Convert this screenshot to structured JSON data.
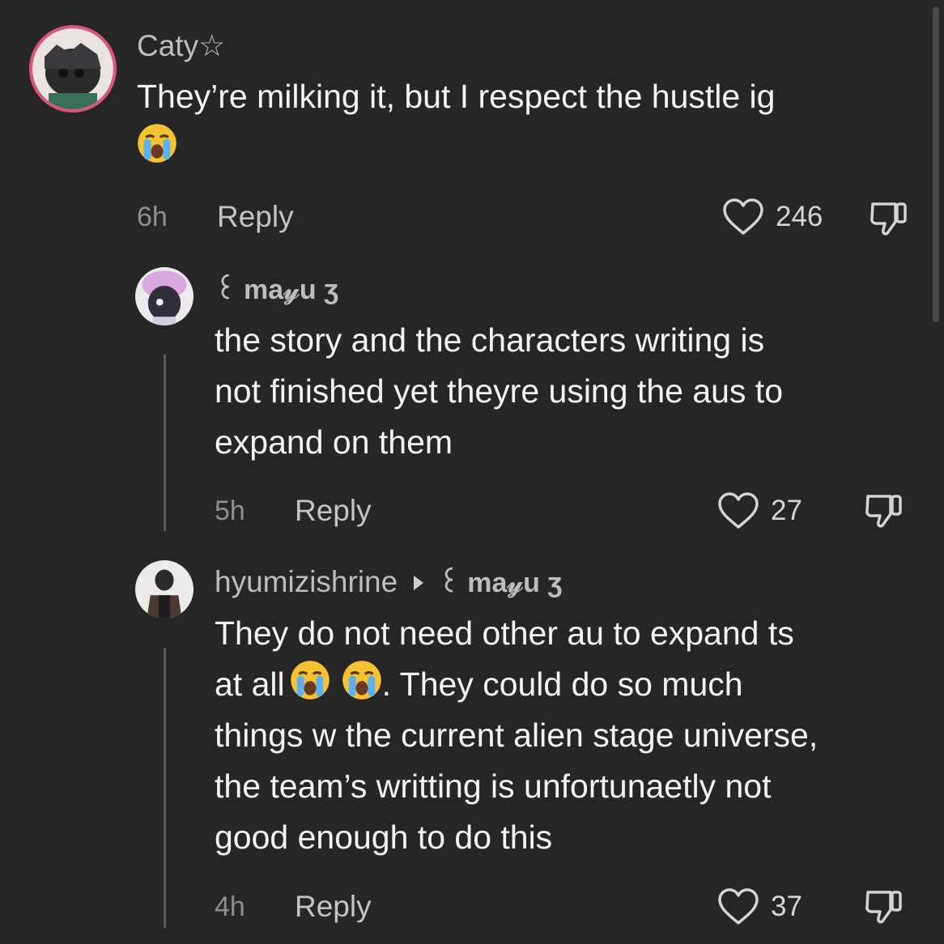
{
  "comments": [
    {
      "username": "Caty☆",
      "lines": [
        "They’re milking it, but I respect the hustle ig"
      ],
      "emoji": "loudly-crying-face",
      "time": "6h",
      "reply_label": "Reply",
      "likes": "246"
    },
    {
      "username": "꒰ ma𝓎u ʒ",
      "lines": [
        "the story and the characters writing is",
        "not finished yet theyre using the aus to",
        "expand on them"
      ],
      "time": "5h",
      "reply_label": "Reply",
      "likes": "27"
    },
    {
      "username": "hyumizishrine",
      "reply_to": "꒰ ma𝓎u ʒ",
      "line1": "They do not need other au to expand ts",
      "line2_start": "at all",
      "line2_end": ". They could do so much",
      "line3": "things w the current alien stage universe,",
      "line4": "the team’s writting is unfortunaetly not",
      "line5": "good enough to do this",
      "time": "4h",
      "reply_label": "Reply",
      "likes": "37"
    }
  ],
  "colors": {
    "background": "#262626",
    "username": "#bdbdbd",
    "text": "#f4f4f4",
    "meta": "#8f8f8f"
  }
}
